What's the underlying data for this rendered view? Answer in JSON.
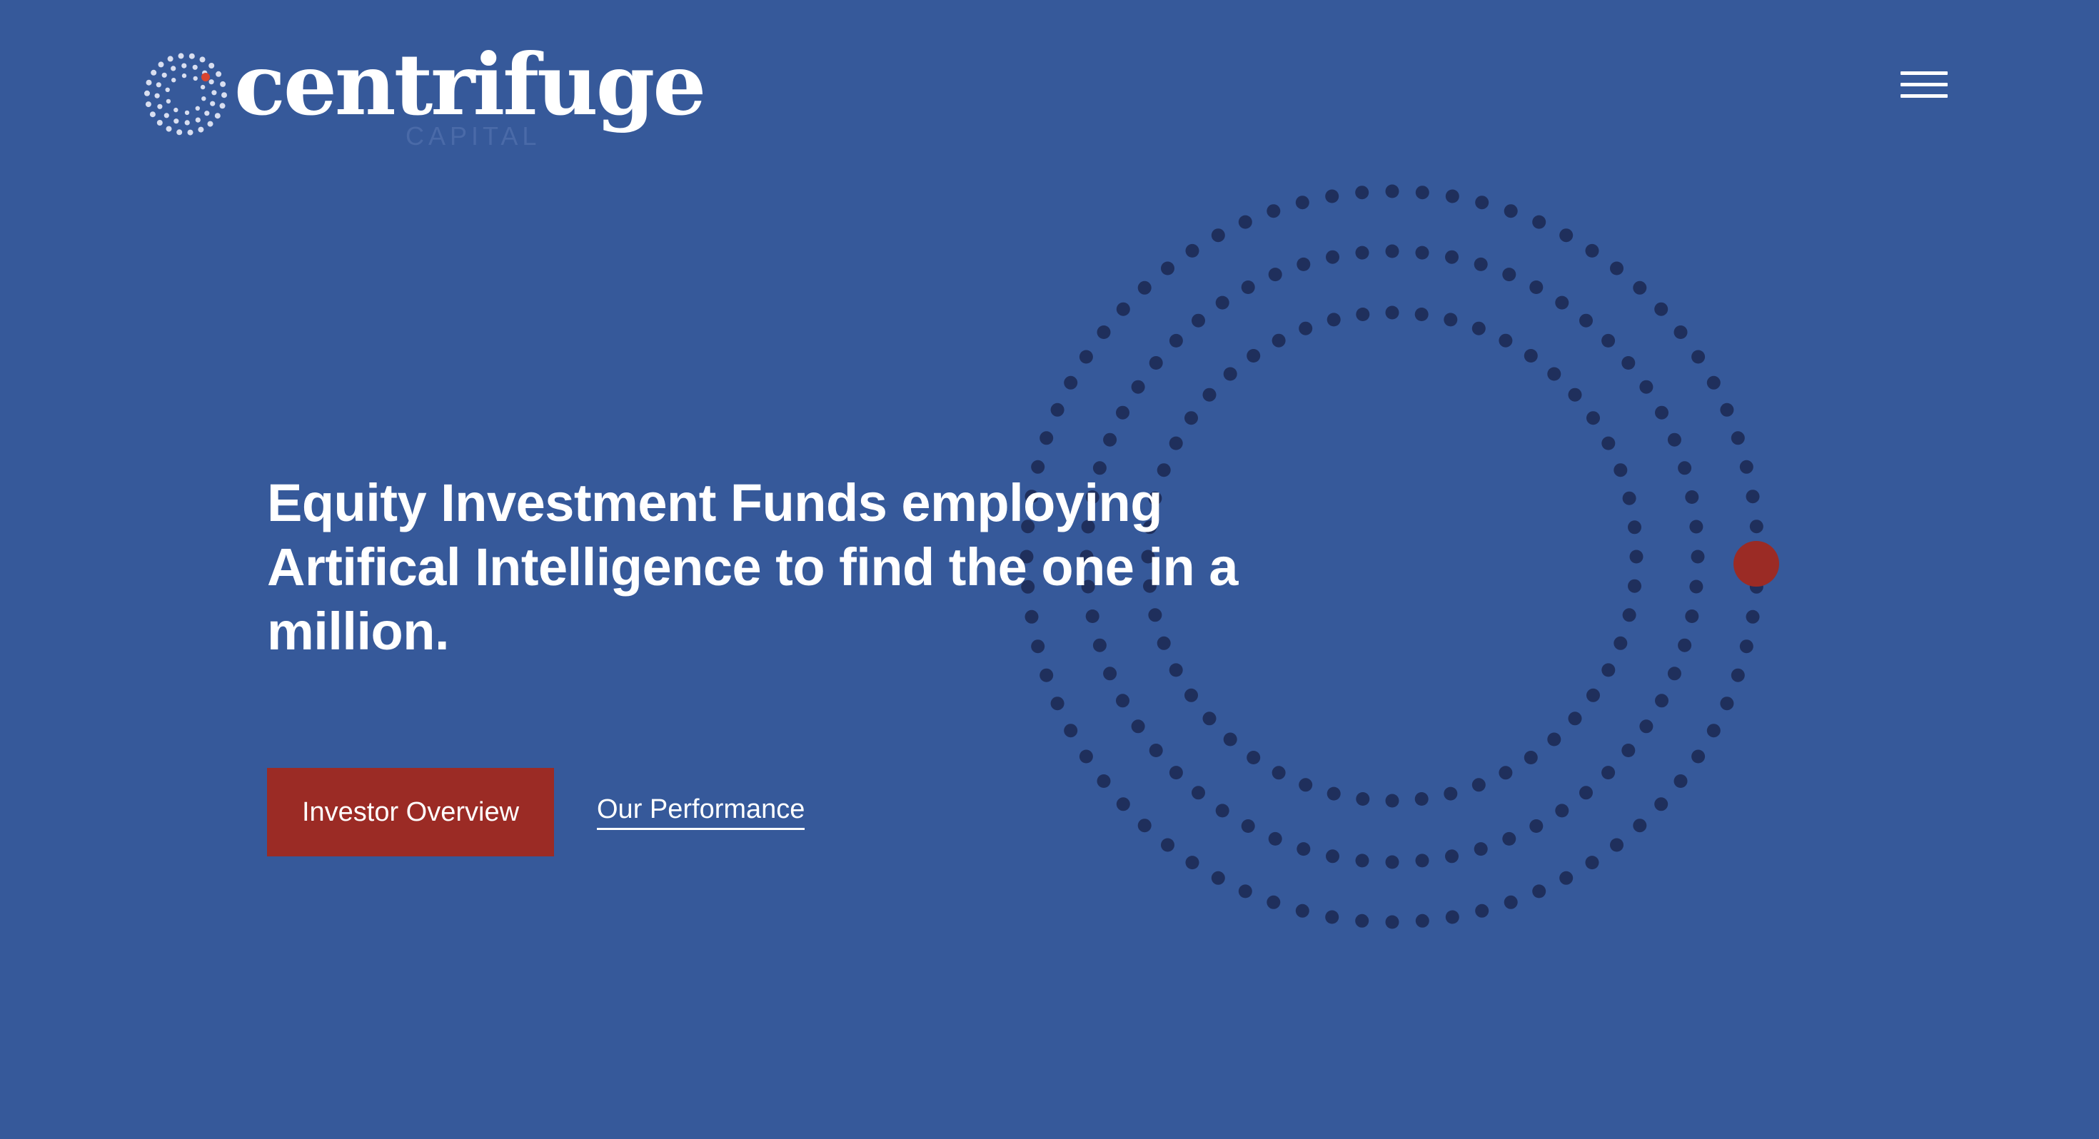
{
  "brand": {
    "name": "centrifuge",
    "tagline": "CAPITAL",
    "logo_icon": "dotted-sphere-icon"
  },
  "header": {
    "menu_icon": "hamburger-menu-icon"
  },
  "hero": {
    "headline": "Equity Investment Funds employing Artifical Intelligence to find the one in a million.",
    "primary_cta": "Investor Overview",
    "secondary_cta": "Our Performance"
  },
  "graphic": {
    "type": "dotted-concentric-rings",
    "highlight_icon": "red-dot"
  },
  "colors": {
    "background": "#36599a",
    "accent": "#9b2b25",
    "ring_dots": "#1f2f5c",
    "text": "#ffffff"
  }
}
